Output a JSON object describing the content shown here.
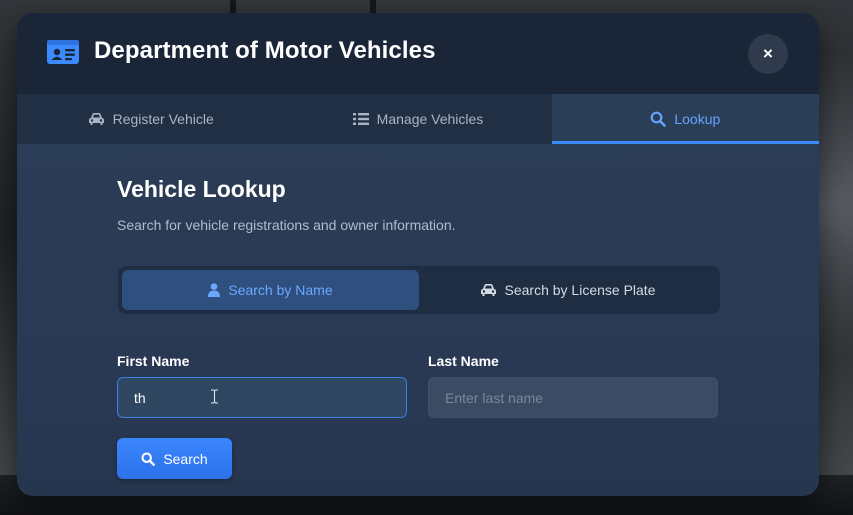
{
  "window": {
    "title": "Department of Motor Vehicles",
    "close_label": "×"
  },
  "tabs": [
    {
      "label": "Register Vehicle",
      "icon": "car-icon",
      "active": false
    },
    {
      "label": "Manage Vehicles",
      "icon": "list-icon",
      "active": false
    },
    {
      "label": "Lookup",
      "icon": "search-icon",
      "active": true
    }
  ],
  "lookup": {
    "title": "Vehicle Lookup",
    "subtitle": "Search for vehicle registrations and owner information.",
    "modes": [
      {
        "label": "Search by Name",
        "icon": "user-icon",
        "active": true
      },
      {
        "label": "Search by License Plate",
        "icon": "car-icon",
        "active": false
      }
    ],
    "first_name": {
      "label": "First Name",
      "value": "th",
      "placeholder": ""
    },
    "last_name": {
      "label": "Last Name",
      "value": "",
      "placeholder": "Enter last name"
    },
    "search_label": "Search"
  },
  "colors": {
    "accent": "#3b8bff",
    "modal_bg": "#2a3a55",
    "header_bg": "#1a2638"
  }
}
